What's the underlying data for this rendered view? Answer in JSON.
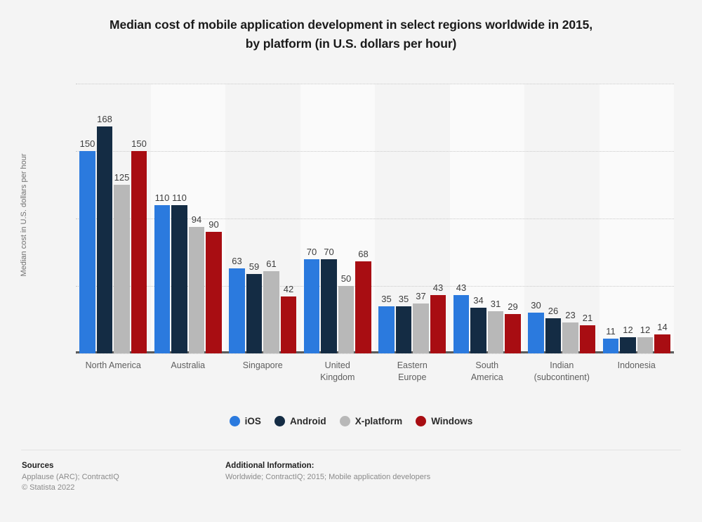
{
  "title": {
    "line1": "Median cost of mobile application development in select regions worldwide in 2015,",
    "line2": "by platform (in U.S. dollars per hour)"
  },
  "chart_data": {
    "type": "bar",
    "title": "Median cost of mobile application development in select regions worldwide in 2015, by platform (in U.S. dollars per hour)",
    "xlabel": "",
    "ylabel": "Median cost in U.S. dollars per hour",
    "ylim": [
      0,
      200
    ],
    "yticks": [
      "0",
      "50",
      "100",
      "150",
      "200"
    ],
    "grid": true,
    "legend_position": "bottom",
    "categories": [
      "North America",
      "Australia",
      "Singapore",
      "United\nKingdom",
      "Eastern\nEurope",
      "South\nAmerica",
      "Indian\n(subcontinent)",
      "Indonesia"
    ],
    "series": [
      {
        "name": "iOS",
        "color": "#2b7ade",
        "values": [
          150,
          110,
          63,
          70,
          35,
          43,
          30,
          11
        ]
      },
      {
        "name": "Android",
        "color": "#142c44",
        "values": [
          168,
          110,
          59,
          70,
          35,
          34,
          26,
          12
        ]
      },
      {
        "name": "X-platform",
        "color": "#b8b8b8",
        "values": [
          125,
          94,
          61,
          50,
          37,
          31,
          23,
          12
        ]
      },
      {
        "name": "Windows",
        "color": "#a80d12",
        "values": [
          150,
          90,
          42,
          68,
          43,
          29,
          21,
          14
        ]
      }
    ]
  },
  "footer": {
    "sources_heading": "Sources",
    "sources_line1": "Applause (ARC); ContractIQ",
    "sources_line2": "© Statista 2022",
    "additional_heading": "Additional Information:",
    "additional_line1": "Worldwide; ContractIQ; 2015; Mobile application developers"
  }
}
